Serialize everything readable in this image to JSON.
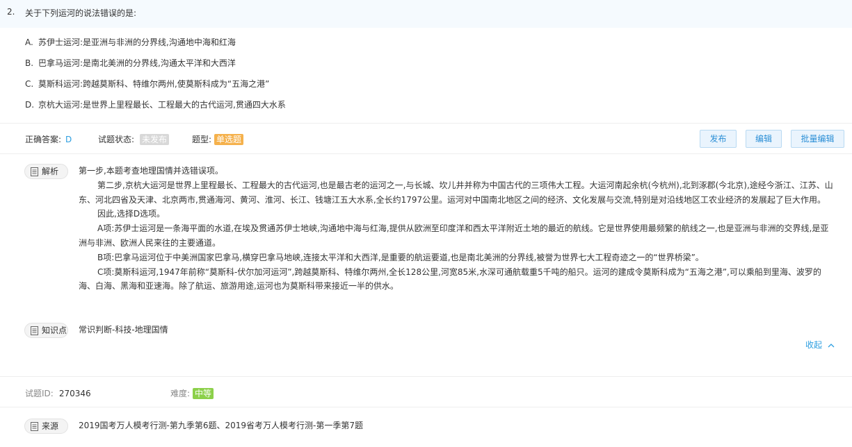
{
  "question": {
    "number": "2.",
    "stem": "关于下列运河的说法错误的是:",
    "options": [
      {
        "letter": "A.",
        "text": "苏伊士运河:是亚洲与非洲的分界线,沟通地中海和红海"
      },
      {
        "letter": "B.",
        "text": "巴拿马运河:是南北美洲的分界线,沟通太平洋和大西洋"
      },
      {
        "letter": "C.",
        "text": "莫斯科运河:跨越莫斯科、特维尔两州,使莫斯科成为“五海之港”"
      },
      {
        "letter": "D.",
        "text": "京杭大运河:是世界上里程最长、工程最大的古代运河,贯通四大水系"
      }
    ]
  },
  "meta": {
    "answer_label": "正确答案:",
    "answer_value": "D",
    "status_label": "试题状态:",
    "status_value": "未发布",
    "type_label": "题型:",
    "type_value": "单选题"
  },
  "actions": {
    "publish": "发布",
    "edit": "编辑",
    "batch_edit": "批量编辑"
  },
  "analysis": {
    "tag_label": "解析",
    "paragraphs": [
      "第一步,本题考查地理国情并选错误项。",
      "第二步,京杭大运河是世界上里程最长、工程最大的古代运河,也是最古老的运河之一,与长城、坎儿井并称为中国古代的三项伟大工程。大运河南起余杭(今杭州),北到涿郡(今北京),途经今浙江、江苏、山东、河北四省及天津、北京两市,贯通海河、黄河、淮河、长江、钱塘江五大水系,全长约1797公里。运河对中国南北地区之间的经济、文化发展与交流,特别是对沿线地区工农业经济的发展起了巨大作用。",
      "因此,选择D选项。",
      "A项:苏伊士运河是一条海平面的水道,在埃及贯通苏伊士地峡,沟通地中海与红海,提供从欧洲至印度洋和西太平洋附近土地的最近的航线。它是世界使用最频繁的航线之一,也是亚洲与非洲的交界线,是亚洲与非洲、欧洲人民来往的主要通道。",
      "B项:巴拿马运河位于中美洲国家巴拿马,横穿巴拿马地峡,连接太平洋和大西洋,是重要的航运要道,也是南北美洲的分界线,被誉为世界七大工程奇迹之一的“世界桥梁”。",
      "C项:莫斯科运河,1947年前称“莫斯科-伏尔加河运河”,跨越莫斯科、特维尔两州,全长128公里,河宽85米,水深可通航载重5千吨的船只。运河的建成令莫斯科成为“五海之港”,可以乘船到里海、波罗的海、白海、黑海和亚速海。除了航运、旅游用途,运河也为莫斯科带来接近一半的供水。"
    ]
  },
  "knowledge": {
    "tag_label": "知识点",
    "text": "常识判断-科技-地理国情"
  },
  "collapse_label": "收起",
  "footer": {
    "id_label": "试题ID:",
    "id_value": "270346",
    "difficulty_label": "难度:",
    "difficulty_value": "中等"
  },
  "source": {
    "tag_label": "来源",
    "text": "2019国考万人模考行测-第九季第6题、2019省考万人模考行测-第一季第7题"
  },
  "colors": {
    "accent": "#2c9ee0",
    "status_badge": "#d8d8d8",
    "type_badge": "#f5b14c",
    "difficulty_badge": "#8cd04a"
  }
}
